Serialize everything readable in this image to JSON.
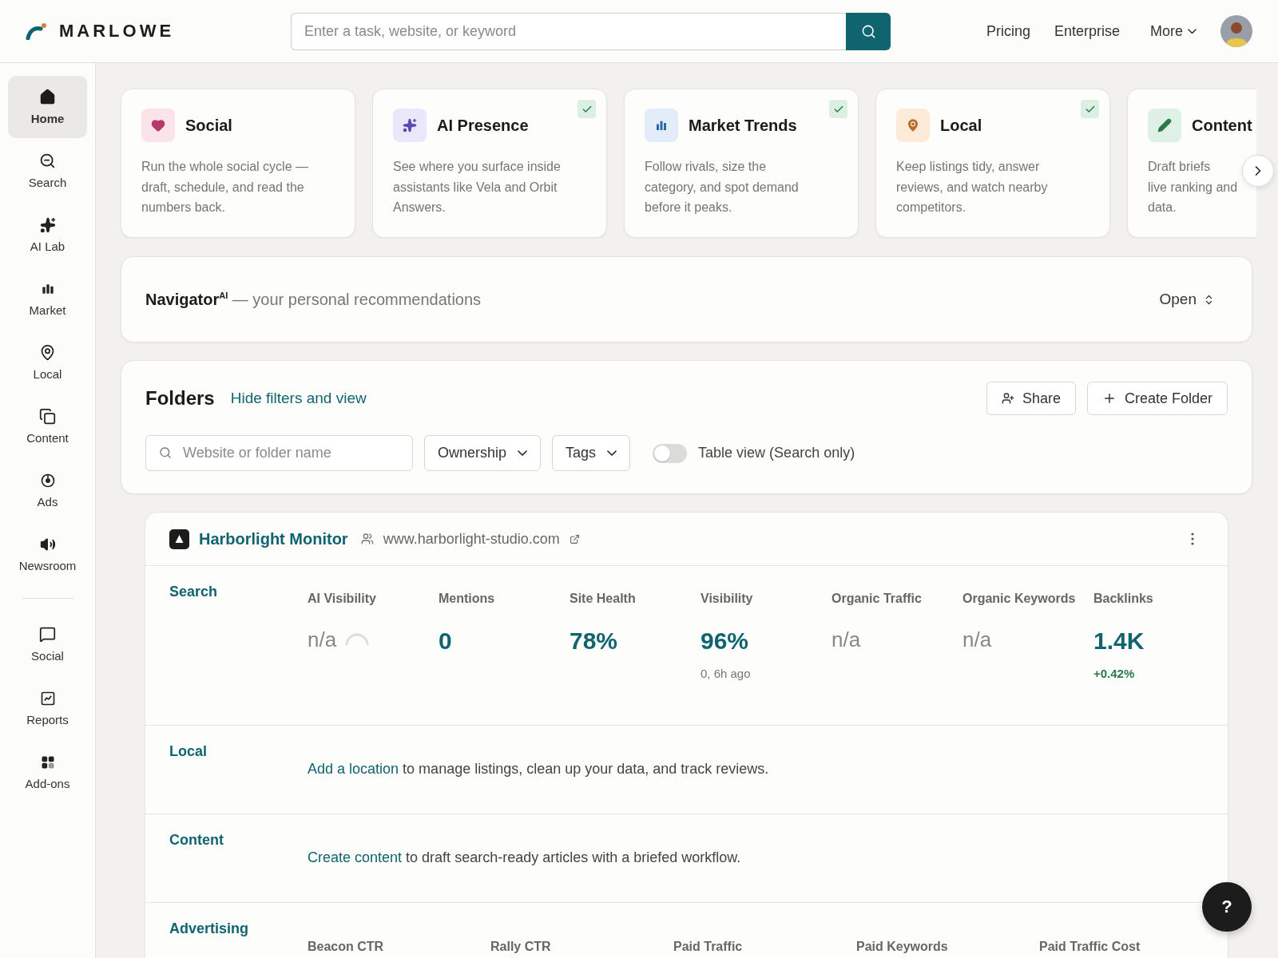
{
  "header": {
    "logo": "MARLOWE",
    "search": {
      "placeholder": "Enter a task, website, or keyword"
    },
    "links": [
      "Pricing",
      "Enterprise"
    ],
    "more": "More"
  },
  "sidebar": {
    "primary": [
      {
        "kind": "home",
        "label": "Home",
        "selected": true
      },
      {
        "kind": "search",
        "label": "Search",
        "selected": false
      },
      {
        "kind": "sparkle",
        "label": "AI Lab",
        "selected": false
      },
      {
        "kind": "bars",
        "label": "Market",
        "selected": false
      },
      {
        "kind": "pin",
        "label": "Local",
        "selected": false
      },
      {
        "kind": "copy",
        "label": "Content",
        "selected": false
      },
      {
        "kind": "target",
        "label": "Ads",
        "selected": false
      },
      {
        "kind": "speaker",
        "label": "Newsroom",
        "selected": false
      }
    ],
    "secondary": [
      {
        "kind": "chat",
        "label": "Social",
        "selected": false
      },
      {
        "kind": "chart",
        "label": "Reports",
        "selected": false
      },
      {
        "kind": "grid",
        "label": "Add-ons",
        "selected": false
      }
    ]
  },
  "cards": [
    {
      "kind": "heart",
      "color": "#fbe3ea",
      "title": "Social",
      "checked": false,
      "lines": [
        "Run the whole social cycle —",
        "draft, schedule, and read the",
        "numbers back."
      ]
    },
    {
      "kind": "sparkle",
      "color": "#ebe7fb",
      "title": "AI Presence",
      "checked": true,
      "lines": [
        "See where you surface inside",
        "assistants like Vela and Orbit",
        "Answers."
      ]
    },
    {
      "kind": "bars",
      "color": "#e2edf9",
      "title": "Market Trends",
      "checked": true,
      "lines": [
        "Follow rivals, size the",
        "category, and spot demand",
        "before it peaks."
      ]
    },
    {
      "kind": "pin",
      "color": "#fdebd9",
      "title": "Local",
      "checked": true,
      "lines": [
        "Keep listings tidy, answer",
        "reviews, and watch nearby",
        "competitors."
      ]
    },
    {
      "kind": "pencil",
      "color": "#dff1e6",
      "title": "Content",
      "checked": false,
      "lines": [
        "Draft briefs",
        "live ranking and",
        "data."
      ]
    }
  ],
  "navigator": {
    "text": "**Navigator**$^{AI}$ — your personal recommendations",
    "action": "Open"
  },
  "folders": {
    "title": "Folders",
    "toggle_link": "Hide filters and view",
    "buttons": [
      {
        "kind": "share",
        "label": "Share"
      },
      {
        "kind": "plus",
        "label": "Create Folder"
      }
    ],
    "filter": {
      "placeholder": "Website or folder name"
    },
    "dropdowns": [
      "Ownership",
      "Tags"
    ],
    "table_view": {
      "label": "Table view (Search only)",
      "on": false
    }
  },
  "site": {
    "name": "Harborlight Monitor",
    "url": "www.harborlight-studio.com",
    "sections": [
      {
        "kind": "metrics",
        "title": "Search",
        "metrics": [
          {
            "label": "AI Visibility",
            "value": "n/a",
            "empty": true,
            "loading": true
          },
          {
            "label": "Mentions",
            "value": "0",
            "empty": false,
            "loading": false
          },
          {
            "label": "Site Health",
            "value": "78%",
            "empty": false,
            "loading": false
          },
          {
            "label": "Visibility",
            "value": "96%",
            "empty": false,
            "loading": false,
            "note": "0, 6h ago",
            "positive": false
          },
          {
            "label": "Organic Traffic",
            "value": "n/a",
            "empty": true,
            "loading": false
          },
          {
            "label": "Organic Keywords",
            "value": "n/a",
            "empty": true,
            "loading": false
          },
          {
            "label": "Backlinks",
            "value": "1.4K",
            "empty": false,
            "loading": false,
            "note": "+0.42%",
            "positive": true
          }
        ]
      },
      {
        "kind": "prompt",
        "title": "Local",
        "link": "Add a location",
        "text": "to manage listings, clean up your data, and track reviews."
      },
      {
        "kind": "prompt",
        "title": "Content",
        "link": "Create content",
        "text": "to draft search-ready articles with a briefed workflow."
      },
      {
        "kind": "labels",
        "title": "Advertising",
        "labels": [
          "Beacon CTR",
          "Rally CTR",
          "Paid Traffic",
          "Paid Keywords",
          "Paid Traffic Cost"
        ]
      }
    ]
  },
  "help": "?"
}
